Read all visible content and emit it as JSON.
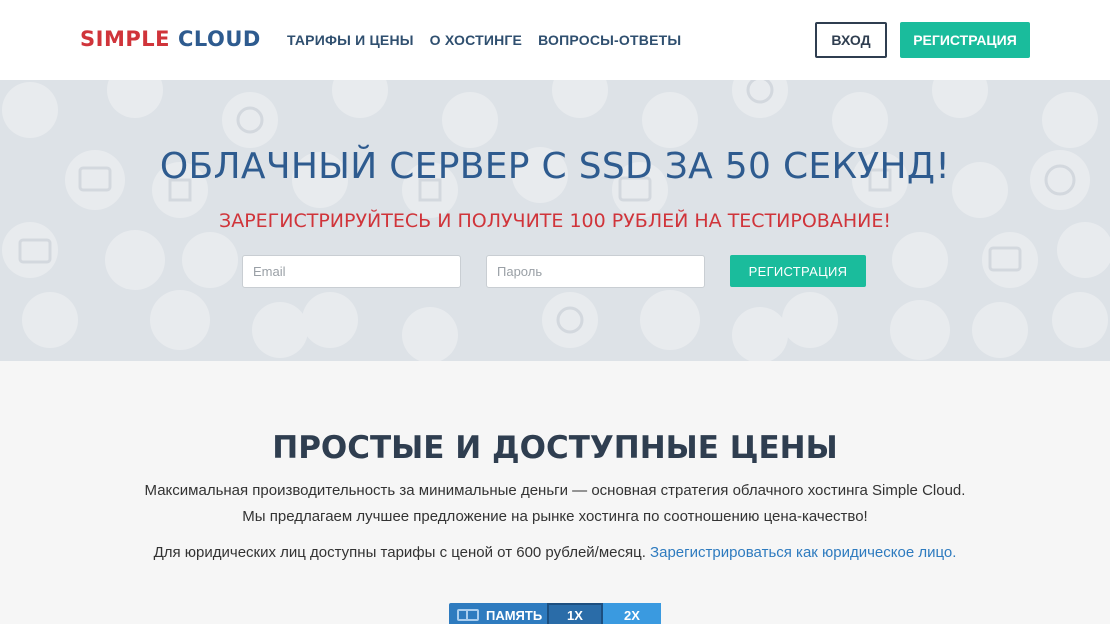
{
  "header": {
    "logo_word1": "SIMPLE",
    "logo_word2": "CLOUD",
    "nav": [
      {
        "label": "ТАРИФЫ И ЦЕНЫ"
      },
      {
        "label": "О ХОСТИНГЕ"
      },
      {
        "label": "ВОПРОСЫ-ОТВЕТЫ"
      }
    ],
    "login_label": "ВХОД",
    "register_label": "РЕГИСТРАЦИЯ"
  },
  "hero": {
    "title": "ОБЛАЧНЫЙ СЕРВЕР С SSD ЗА 50 СЕКУНД!",
    "subtitle": "ЗАРЕГИСТРИРУЙТЕСЬ И ПОЛУЧИТЕ 100 РУБЛЕЙ НА ТЕСТИРОВАНИЕ!",
    "email_placeholder": "Email",
    "password_placeholder": "Пароль",
    "register_label": "РЕГИСТРАЦИЯ"
  },
  "pricing": {
    "title": "ПРОСТЫЕ И ДОСТУПНЫЕ ЦЕНЫ",
    "line1": "Максимальная производительность за минимальные деньги — основная стратегия облачного хостинга Simple Cloud.",
    "line2": "Мы предлагаем лучшее предложение на рынке хостинга по соотношению цена-качество!",
    "line3_text": "Для юридических лиц доступны тарифы с ценой от 600 рублей/месяц.",
    "line3_link": "Зарегистрироваться как юридическое лицо.",
    "toggle": {
      "memory_label": "ПАМЯТЬ",
      "option_1": "1X",
      "option_2": "2X"
    }
  },
  "colors": {
    "brand_red": "#d0343a",
    "brand_blue": "#2e5b8f",
    "accent_green": "#1abc9c",
    "link_blue": "#2e7bbf"
  }
}
